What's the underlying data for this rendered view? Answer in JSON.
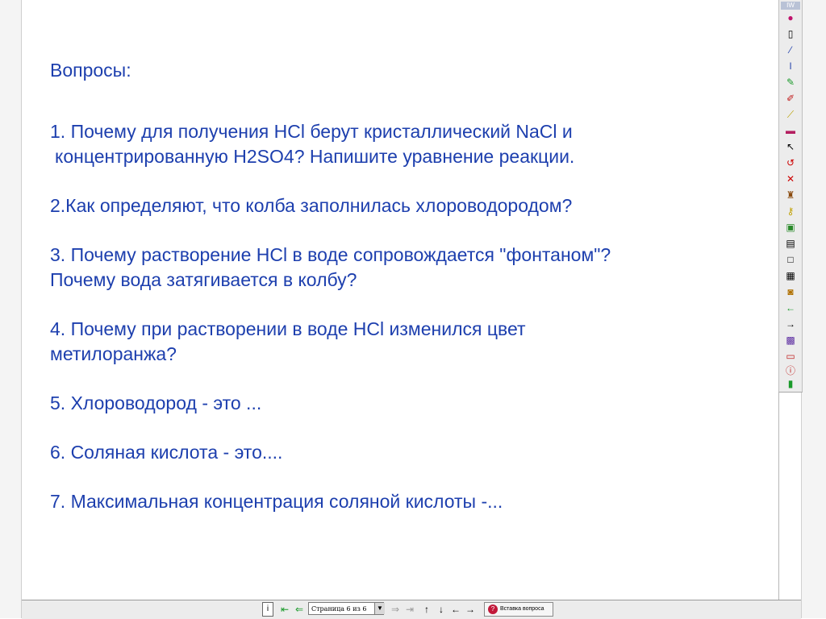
{
  "slide": {
    "heading": "Вопросы:",
    "questions": [
      "1. Почему для получения HCl берут кристаллический NaCl и",
      " концентрированную H2SO4? Напишите уравнение реакции.",
      "2.Как определяют, что колба заполнилась хлороводородом?",
      "3. Почему растворение HCl в воде сопровождается \"фонтаном\"?",
      "Почему вода затягивается в колбу?",
      "4. Почему  при растворении в воде  HCl изменился цвет",
      "метилоранжа?",
      "5. Хлороводород - это ...",
      "6. Соляная кислота - это....",
      "7. Максимальная концентрация соляной кислоты -..."
    ],
    "text_color": "#1d3fae"
  },
  "toolbar": {
    "tab_label": "IW",
    "icons": [
      "color-dot-icon",
      "mouse-icon",
      "pen-icon",
      "line-icon",
      "marker-icon",
      "brush-icon",
      "highlighter-icon",
      "eraser-icon",
      "pointer-icon",
      "undo-icon",
      "delete-icon",
      "stamp-icon",
      "key-icon",
      "image-icon",
      "picture-icon",
      "page-icon",
      "grid-icon",
      "screen-icon",
      "arrow-left-icon",
      "arrow-right-icon",
      "keyboard-icon",
      "gallery-icon",
      "info-icon",
      "exit-icon"
    ]
  },
  "bottom_bar": {
    "page_indicator": "Страница 6 из 6",
    "insert_question_label": "Вставка вопроса"
  }
}
